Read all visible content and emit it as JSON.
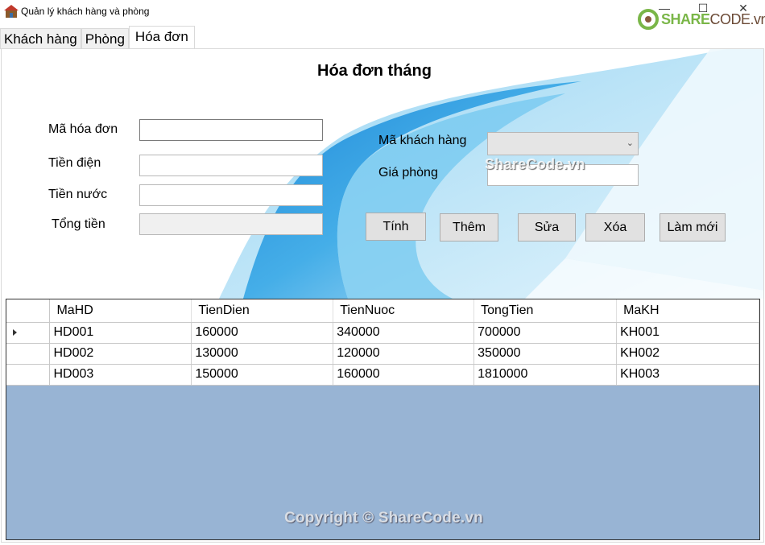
{
  "window": {
    "title": "Quản lý khách hàng và phòng",
    "minimize_label": "—",
    "maximize_label": "☐",
    "close_label": "✕",
    "watermark_logo": {
      "share": "SHARE",
      "code": "CODE.vn"
    }
  },
  "tabs": [
    {
      "label": "Khách hàng",
      "active": false
    },
    {
      "label": "Phòng",
      "active": false
    },
    {
      "label": "Hóa đơn",
      "active": true
    }
  ],
  "form": {
    "heading": "Hóa đơn tháng",
    "fields": {
      "ma_hoa_don": {
        "label": "Mã hóa đơn",
        "value": ""
      },
      "tien_dien": {
        "label": "Tiền điện",
        "value": ""
      },
      "tien_nuoc": {
        "label": "Tiền nước",
        "value": ""
      },
      "tong_tien": {
        "label": "Tổng tiền",
        "value": ""
      },
      "ma_khach_hang": {
        "label": "Mã khách hàng",
        "value": ""
      },
      "gia_phong": {
        "label": "Giá phòng",
        "value": ""
      }
    },
    "buttons": {
      "tinh": "Tính",
      "them": "Thêm",
      "sua": "Sửa",
      "xoa": "Xóa",
      "lam_moi": "Làm mới"
    },
    "watermark": "ShareCode.vn"
  },
  "grid": {
    "columns": [
      "MaHD",
      "TienDien",
      "TienNuoc",
      "TongTien",
      "MaKH"
    ],
    "rows": [
      [
        "HD001",
        "160000",
        "340000",
        "700000",
        "KH001"
      ],
      [
        "HD002",
        "130000",
        "120000",
        "350000",
        "KH002"
      ],
      [
        "HD003",
        "150000",
        "160000",
        "1810000",
        "KH003"
      ]
    ],
    "current_row": 0,
    "background_color": "#98b4d4"
  },
  "copyright": "Copyright © ShareCode.vn"
}
